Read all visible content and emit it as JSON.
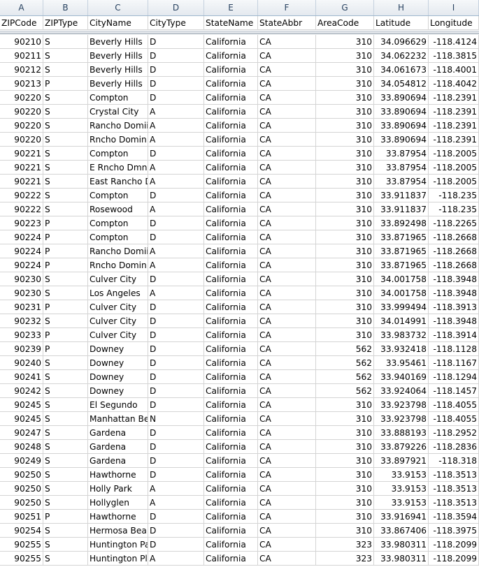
{
  "column_letters": [
    "A",
    "B",
    "C",
    "D",
    "E",
    "F",
    "G",
    "H",
    "I"
  ],
  "headers": [
    "ZIPCode",
    "ZIPType",
    "CityName",
    "CityType",
    "StateName",
    "StateAbbr",
    "AreaCode",
    "Latitude",
    "Longitude"
  ],
  "rows": [
    [
      "90210",
      "S",
      "Beverly Hills",
      "D",
      "California",
      "CA",
      "310",
      "34.096629",
      "-118.4124"
    ],
    [
      "90211",
      "S",
      "Beverly Hills",
      "D",
      "California",
      "CA",
      "310",
      "34.062232",
      "-118.3815"
    ],
    [
      "90212",
      "S",
      "Beverly Hills",
      "D",
      "California",
      "CA",
      "310",
      "34.061673",
      "-118.4001"
    ],
    [
      "90213",
      "P",
      "Beverly Hills",
      "D",
      "California",
      "CA",
      "310",
      "34.054812",
      "-118.4042"
    ],
    [
      "90220",
      "S",
      "Compton",
      "D",
      "California",
      "CA",
      "310",
      "33.890694",
      "-118.2391"
    ],
    [
      "90220",
      "S",
      "Crystal City",
      "A",
      "California",
      "CA",
      "310",
      "33.890694",
      "-118.2391"
    ],
    [
      "90220",
      "S",
      "Rancho Domii",
      "A",
      "California",
      "CA",
      "310",
      "33.890694",
      "-118.2391"
    ],
    [
      "90220",
      "S",
      "Rncho Domin",
      "A",
      "California",
      "CA",
      "310",
      "33.890694",
      "-118.2391"
    ],
    [
      "90221",
      "S",
      "Compton",
      "D",
      "California",
      "CA",
      "310",
      "33.87954",
      "-118.2005"
    ],
    [
      "90221",
      "S",
      "E Rncho Dmng",
      "A",
      "California",
      "CA",
      "310",
      "33.87954",
      "-118.2005"
    ],
    [
      "90221",
      "S",
      "East Rancho D",
      "A",
      "California",
      "CA",
      "310",
      "33.87954",
      "-118.2005"
    ],
    [
      "90222",
      "S",
      "Compton",
      "D",
      "California",
      "CA",
      "310",
      "33.911837",
      "-118.235"
    ],
    [
      "90222",
      "S",
      "Rosewood",
      "A",
      "California",
      "CA",
      "310",
      "33.911837",
      "-118.235"
    ],
    [
      "90223",
      "P",
      "Compton",
      "D",
      "California",
      "CA",
      "310",
      "33.892498",
      "-118.2265"
    ],
    [
      "90224",
      "P",
      "Compton",
      "D",
      "California",
      "CA",
      "310",
      "33.871965",
      "-118.2668"
    ],
    [
      "90224",
      "P",
      "Rancho Domii",
      "A",
      "California",
      "CA",
      "310",
      "33.871965",
      "-118.2668"
    ],
    [
      "90224",
      "P",
      "Rncho Domin",
      "A",
      "California",
      "CA",
      "310",
      "33.871965",
      "-118.2668"
    ],
    [
      "90230",
      "S",
      "Culver City",
      "D",
      "California",
      "CA",
      "310",
      "34.001758",
      "-118.3948"
    ],
    [
      "90230",
      "S",
      "Los Angeles",
      "A",
      "California",
      "CA",
      "310",
      "34.001758",
      "-118.3948"
    ],
    [
      "90231",
      "P",
      "Culver City",
      "D",
      "California",
      "CA",
      "310",
      "33.999494",
      "-118.3913"
    ],
    [
      "90232",
      "S",
      "Culver City",
      "D",
      "California",
      "CA",
      "310",
      "34.014991",
      "-118.3948"
    ],
    [
      "90233",
      "P",
      "Culver City",
      "D",
      "California",
      "CA",
      "310",
      "33.983732",
      "-118.3914"
    ],
    [
      "90239",
      "P",
      "Downey",
      "D",
      "California",
      "CA",
      "562",
      "33.932418",
      "-118.1128"
    ],
    [
      "90240",
      "S",
      "Downey",
      "D",
      "California",
      "CA",
      "562",
      "33.95461",
      "-118.1167"
    ],
    [
      "90241",
      "S",
      "Downey",
      "D",
      "California",
      "CA",
      "562",
      "33.940169",
      "-118.1294"
    ],
    [
      "90242",
      "S",
      "Downey",
      "D",
      "California",
      "CA",
      "562",
      "33.924064",
      "-118.1457"
    ],
    [
      "90245",
      "S",
      "El Segundo",
      "D",
      "California",
      "CA",
      "310",
      "33.923798",
      "-118.4055"
    ],
    [
      "90245",
      "S",
      "Manhattan Be",
      "N",
      "California",
      "CA",
      "310",
      "33.923798",
      "-118.4055"
    ],
    [
      "90247",
      "S",
      "Gardena",
      "D",
      "California",
      "CA",
      "310",
      "33.888193",
      "-118.2952"
    ],
    [
      "90248",
      "S",
      "Gardena",
      "D",
      "California",
      "CA",
      "310",
      "33.879226",
      "-118.2836"
    ],
    [
      "90249",
      "S",
      "Gardena",
      "D",
      "California",
      "CA",
      "310",
      "33.897921",
      "-118.318"
    ],
    [
      "90250",
      "S",
      "Hawthorne",
      "D",
      "California",
      "CA",
      "310",
      "33.9153",
      "-118.3513"
    ],
    [
      "90250",
      "S",
      "Holly Park",
      "A",
      "California",
      "CA",
      "310",
      "33.9153",
      "-118.3513"
    ],
    [
      "90250",
      "S",
      "Hollyglen",
      "A",
      "California",
      "CA",
      "310",
      "33.9153",
      "-118.3513"
    ],
    [
      "90251",
      "P",
      "Hawthorne",
      "D",
      "California",
      "CA",
      "310",
      "33.916941",
      "-118.3594"
    ],
    [
      "90254",
      "S",
      "Hermosa Bea",
      "D",
      "California",
      "CA",
      "310",
      "33.867406",
      "-118.3975"
    ],
    [
      "90255",
      "S",
      "Huntington Pa",
      "D",
      "California",
      "CA",
      "323",
      "33.980311",
      "-118.2099"
    ],
    [
      "90255",
      "S",
      "Huntington Pl",
      "A",
      "California",
      "CA",
      "323",
      "33.980311",
      "-118.2099"
    ]
  ]
}
